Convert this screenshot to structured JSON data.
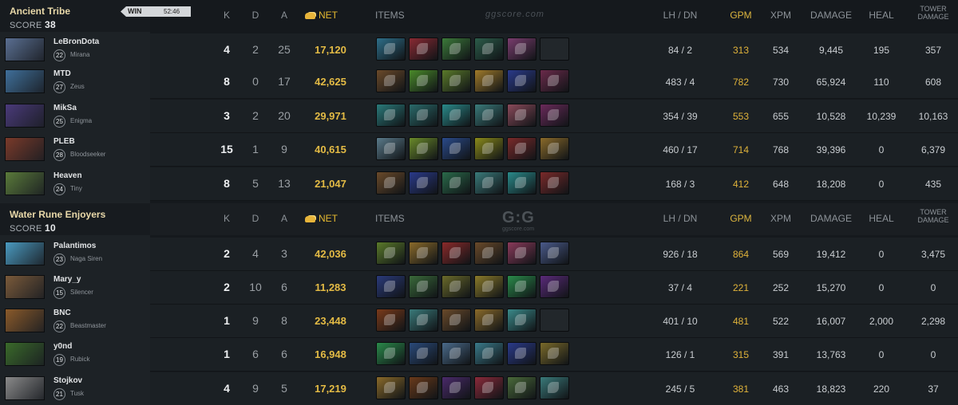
{
  "header": {
    "k": "K",
    "d": "D",
    "a": "A",
    "net": "NET",
    "items": "ITEMS",
    "lhdn": "LH / DN",
    "gpm": "GPM",
    "xpm": "XPM",
    "damage": "DAMAGE",
    "heal": "HEAL",
    "tower1": "TOWER",
    "tower2": "DAMAGE"
  },
  "watermark": {
    "text1": "ggscore.com",
    "text2": "G:G",
    "text3": "ggscore.com"
  },
  "teams": [
    {
      "name": "Ancient Tribe",
      "score_label": "SCORE",
      "score": "38",
      "result": "WIN",
      "time": "52:46",
      "players": [
        {
          "name": "LeBronDota",
          "level": "22",
          "hero": "Mirana",
          "k": "4",
          "d": "2",
          "a": "25",
          "net": "17,120",
          "lhdn": "84 / 2",
          "gpm": "313",
          "xpm": "534",
          "damage": "9,445",
          "heal": "195",
          "tower": "357",
          "items": [
            "#2e6f8a",
            "#8a2a33",
            "#3c7a3a",
            "#2c5c4a",
            "#7a3d6e",
            "empty"
          ]
        },
        {
          "name": "MTD",
          "level": "27",
          "hero": "Zeus",
          "k": "8",
          "d": "0",
          "a": "17",
          "net": "42,625",
          "lhdn": "483 / 4",
          "gpm": "782",
          "xpm": "730",
          "damage": "65,924",
          "heal": "110",
          "tower": "608",
          "items": [
            "#6b4a2a",
            "#4a8a2a",
            "#5a7a2a",
            "#a07a2a",
            "#2a3a8a",
            "#6a2a4a"
          ]
        },
        {
          "name": "MikSa",
          "level": "25",
          "hero": "Enigma",
          "k": "3",
          "d": "2",
          "a": "20",
          "net": "29,971",
          "lhdn": "354 / 39",
          "gpm": "553",
          "xpm": "655",
          "damage": "10,528",
          "heal": "10,239",
          "tower": "10,163",
          "items": [
            "#2a7a7a",
            "#2a6a6a",
            "#2a8a8a",
            "#3a7a7a",
            "#8a4a5a",
            "#6a2a5a"
          ]
        },
        {
          "name": "PLEB",
          "level": "28",
          "hero": "Bloodseeker",
          "k": "15",
          "d": "1",
          "a": "9",
          "net": "40,615",
          "lhdn": "460 / 17",
          "gpm": "714",
          "xpm": "768",
          "damage": "39,396",
          "heal": "0",
          "tower": "6,379",
          "items": [
            "#5a7a8a",
            "#6a8a2a",
            "#2a4a8a",
            "#8a8a1a",
            "#7a2a2a",
            "#8a6a2a"
          ]
        },
        {
          "name": "Heaven",
          "level": "24",
          "hero": "Tiny",
          "k": "8",
          "d": "5",
          "a": "13",
          "net": "21,047",
          "lhdn": "168 / 3",
          "gpm": "412",
          "xpm": "648",
          "damage": "18,208",
          "heal": "0",
          "tower": "435",
          "items": [
            "#6a4a2a",
            "#2a3a8a",
            "#2a6a4a",
            "#3a7a7a",
            "#2a8a8a",
            "#7a2a2a"
          ]
        }
      ]
    },
    {
      "name": "Water Rune Enjoyers",
      "score_label": "SCORE",
      "score": "10",
      "players": [
        {
          "name": "Palantimos",
          "level": "23",
          "hero": "Naga Siren",
          "k": "2",
          "d": "4",
          "a": "3",
          "net": "42,036",
          "lhdn": "926 / 18",
          "gpm": "864",
          "xpm": "569",
          "damage": "19,412",
          "heal": "0",
          "tower": "3,475",
          "items": [
            "#5a7a2a",
            "#8a6a2a",
            "#8a2a2a",
            "#6a4a2a",
            "#8a3a5a",
            "#4a5a8a"
          ]
        },
        {
          "name": "Mary_y",
          "level": "15",
          "hero": "Silencer",
          "k": "2",
          "d": "10",
          "a": "6",
          "net": "11,283",
          "lhdn": "37 / 4",
          "gpm": "221",
          "xpm": "252",
          "damage": "15,270",
          "heal": "0",
          "tower": "0",
          "items": [
            "#2a3a7a",
            "#3a6a3a",
            "#6a6a2a",
            "#8a7a2a",
            "#2a8a4a",
            "#5a2a7a"
          ]
        },
        {
          "name": "BNC",
          "level": "22",
          "hero": "Beastmaster",
          "k": "1",
          "d": "9",
          "a": "8",
          "net": "23,448",
          "lhdn": "401 / 10",
          "gpm": "481",
          "xpm": "522",
          "damage": "16,007",
          "heal": "2,000",
          "tower": "2,298",
          "items": [
            "#7a3a1a",
            "#3a7a7a",
            "#6a4a2a",
            "#8a6a2a",
            "#3a8a8a",
            "empty"
          ]
        },
        {
          "name": "y0nd",
          "level": "19",
          "hero": "Rubick",
          "k": "1",
          "d": "6",
          "a": "6",
          "net": "16,948",
          "lhdn": "126 / 1",
          "gpm": "315",
          "xpm": "391",
          "damage": "13,763",
          "heal": "0",
          "tower": "0",
          "items": [
            "#2a8a4a",
            "#2a4a7a",
            "#4a6a8a",
            "#3a7a8a",
            "#2a3a8a",
            "#7a6a2a"
          ]
        },
        {
          "name": "Stojkov",
          "level": "21",
          "hero": "Tusk",
          "k": "4",
          "d": "9",
          "a": "5",
          "net": "17,219",
          "lhdn": "245 / 5",
          "gpm": "381",
          "xpm": "463",
          "damage": "18,823",
          "heal": "220",
          "tower": "37",
          "items": [
            "#8a6a2a",
            "#6a3a1a",
            "#4a2a6a",
            "#8a2a3a",
            "#4a6a3a",
            "#3a7a7a"
          ]
        }
      ]
    }
  ],
  "avatar_colors": [
    "#5a6f92",
    "#3f6f9a",
    "#4a3a7a",
    "#7a3a2a",
    "#5a7a3a",
    "#4a9ac0",
    "#7a5a3a",
    "#8a5a2a",
    "#3a6a2a",
    "#8a8a8a"
  ]
}
